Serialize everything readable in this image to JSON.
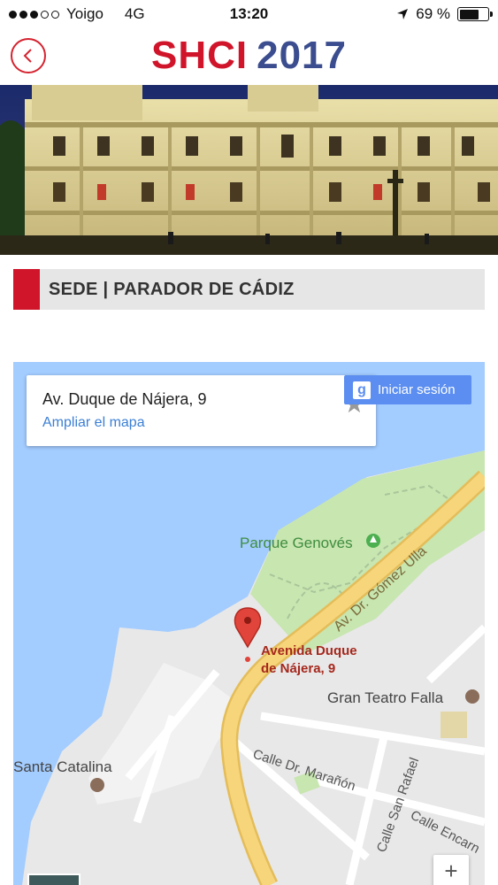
{
  "status_bar": {
    "carrier": "Yoigo",
    "network": "4G",
    "time": "13:20",
    "battery": "69 %",
    "signal_bars": 3,
    "signal_total": 5,
    "battery_level": 0.69,
    "icons": [
      "signal-dots-icon",
      "location-arrow-icon",
      "battery-icon"
    ]
  },
  "header": {
    "brand_primary": "SHCI",
    "brand_secondary": "2017",
    "back_icon": "chevron-left-icon",
    "colors": {
      "primary": "#d0152b",
      "secondary": "#3b4d8f"
    }
  },
  "section": {
    "title": "SEDE | PARADOR DE CÁDIZ",
    "accent_color": "#d0152b"
  },
  "map": {
    "address": "Av. Duque de Nájera, 9",
    "enlarge_link": "Ampliar el mapa",
    "signin": "Iniciar sesión",
    "zoom_in": "+",
    "pin_label_line1": "Avenida Duque",
    "pin_label_line2": "de Nájera, 9",
    "labels": {
      "park": "Parque Genovés",
      "avenue": "Av. Dr. Gómez Ulla",
      "theatre": "Gran Teatro Falla",
      "santa_catalina": "Santa Catalina",
      "maranon": "Calle Dr. Marañón",
      "san_rafael": "Calle San Rafael",
      "encarnacion": "Calle Encarn"
    },
    "colors": {
      "water": "#a3ccff",
      "land": "#e8e8e8",
      "park": "#c8e6b0",
      "main_road": "#f7d57b"
    }
  }
}
